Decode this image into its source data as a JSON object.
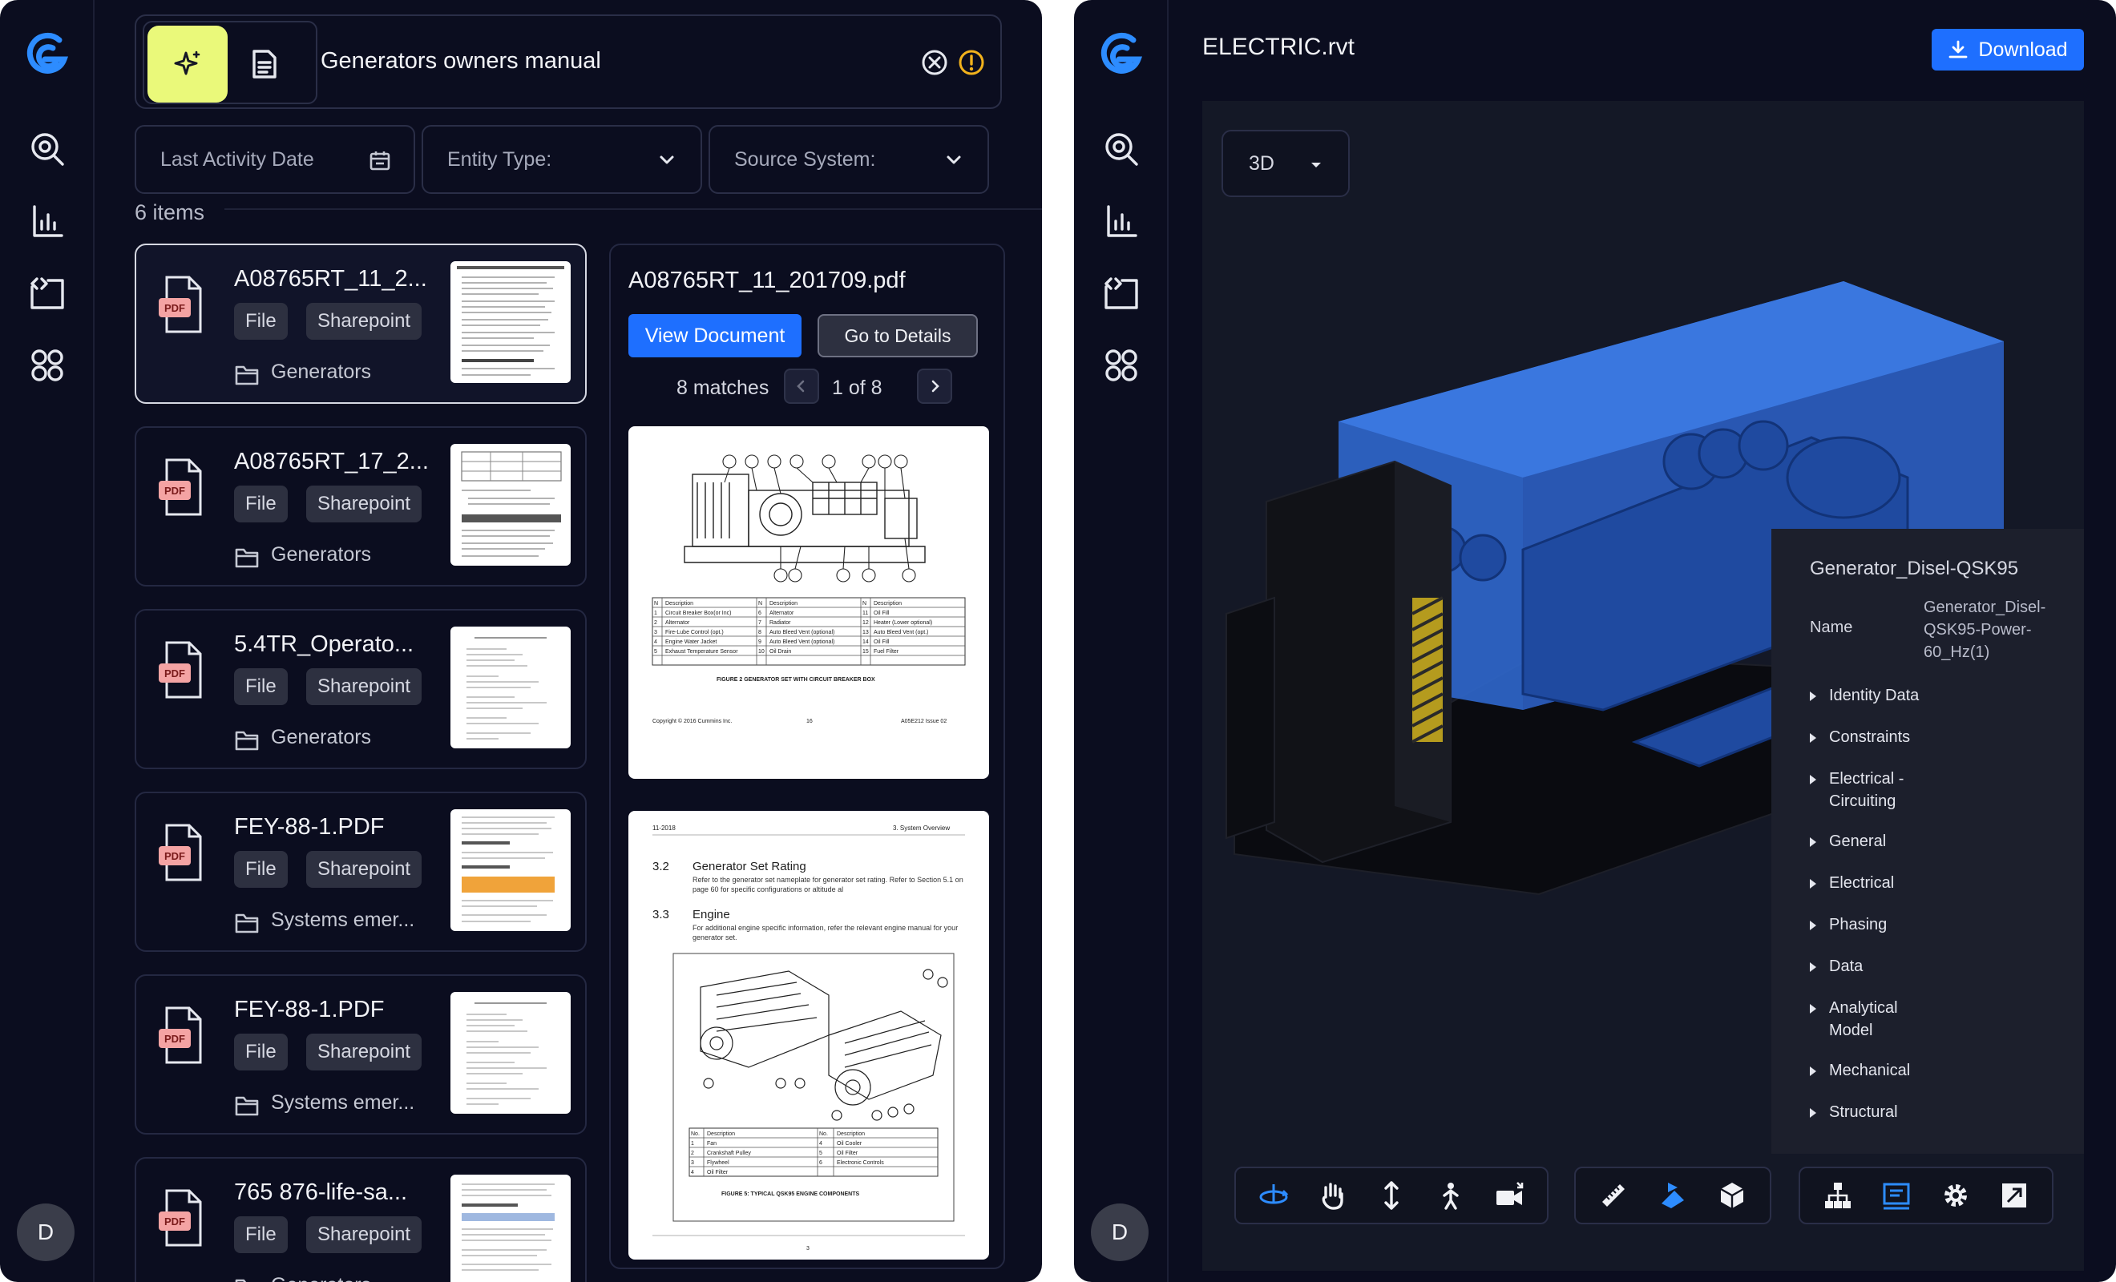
{
  "search": {
    "query": "Generators owners manual",
    "filters": {
      "date": "Last Activity Date",
      "entity": "Entity Type:",
      "source": "Source System:"
    },
    "items_count": "6 items"
  },
  "results": [
    {
      "title": "A08765RT_11_2...",
      "file_badge": "PDF",
      "type": "File",
      "source": "Sharepoint",
      "folder": "Generators"
    },
    {
      "title": "A08765RT_17_2...",
      "file_badge": "PDF",
      "type": "File",
      "source": "Sharepoint",
      "folder": "Generators"
    },
    {
      "title": "5.4TR_Operato...",
      "file_badge": "PDF",
      "type": "File",
      "source": "Sharepoint",
      "folder": "Generators"
    },
    {
      "title": "FEY-88-1.PDF",
      "file_badge": "PDF",
      "type": "File",
      "source": "Sharepoint",
      "folder": "Systems emer..."
    },
    {
      "title": "FEY-88-1.PDF",
      "file_badge": "PDF",
      "type": "File",
      "source": "Sharepoint",
      "folder": "Systems emer..."
    },
    {
      "title": "765 876-life-sa...",
      "file_badge": "PDF",
      "type": "File",
      "source": "Sharepoint",
      "folder": "Generators"
    }
  ],
  "preview": {
    "title": "A08765RT_11_201709.pdf",
    "view_button": "View Document",
    "details_button": "Go to Details",
    "matches": "8 matches",
    "page_indicator": "1 of 8",
    "page1": {
      "figure_caption": "FIGURE 2   GENERATOR SET WITH CIRCUIT BREAKER BOX",
      "footer_left": "Copyright © 2016 Cummins Inc.",
      "footer_mid": "16",
      "footer_right": "A05E212 Issue 02",
      "table_header": [
        "N",
        "Description",
        "N",
        "Description",
        "N",
        "Description"
      ],
      "table_rows": [
        [
          "1",
          "Circuit Breaker Box(or Inc)",
          "6",
          "Alternator",
          "11",
          "Oil Fill"
        ],
        [
          "2",
          "Alternator",
          "7",
          "Radiator",
          "12",
          "Heater (Lower optional)"
        ],
        [
          "3",
          "Fire-Lube Control (opt.)",
          "8",
          "Auto Bleed Vent (optional)",
          "13",
          "Auto Bleed Vent (opt.)"
        ],
        [
          "4",
          "Engine Water Jacket",
          "9",
          "Auto Bleed Vent (optional)",
          "14",
          "Oil Fill"
        ],
        [
          "5",
          "Exhaust Temperature Sensor",
          "10",
          "Oil Drain",
          "15",
          "Fuel Filter"
        ]
      ]
    },
    "page2": {
      "header_left": "11-2018",
      "header_right": "3. System Overview",
      "s1_num": "3.2",
      "s1_title": "Generator Set Rating",
      "s1_body": "Refer to the generator set nameplate for generator set rating. Refer to Section 5.1 on page 60 for specific configurations or altitude al",
      "s2_num": "3.3",
      "s2_title": "Engine",
      "s2_body": "For additional engine specific information, refer the relevant engine manual for your generator set.",
      "figure_caption": "FIGURE 5: TYPICAL QSK95 ENGINE COMPONENTS",
      "page_num": "3",
      "table_header": [
        "No.",
        "Description",
        "No.",
        "Description"
      ],
      "table_rows": [
        [
          "1",
          "Fan",
          "4",
          "Oil Cooler"
        ],
        [
          "2",
          "Crankshaft Pulley",
          "5",
          "Oil Filter"
        ],
        [
          "3",
          "Flywheel",
          "6",
          "Electronic Controls"
        ],
        [
          "4",
          "Oil Filter",
          "",
          ""
        ]
      ]
    }
  },
  "viewer": {
    "file_title": "ELECTRIC.rvt",
    "download_label": "Download",
    "view_mode": "3D",
    "properties": {
      "title": "Generator_Disel-QSK95",
      "name_label": "Name",
      "name_value": "Generator_Disel-QSK95-Power-60_Hz(1)",
      "categories": [
        "Identity Data",
        "Constraints",
        "Electrical - Circuiting",
        "General",
        "Electrical",
        "Phasing",
        "Data",
        "Analytical Model",
        "Mechanical",
        "Structural"
      ]
    }
  },
  "user": {
    "initial": "D"
  },
  "colors": {
    "accent": "#1e6fff",
    "ai_button": "#eaf97a",
    "panel_bg": "#0b0d1f",
    "pdf_badge": "#f4a3a3",
    "model_blue": "#2f66c9"
  }
}
